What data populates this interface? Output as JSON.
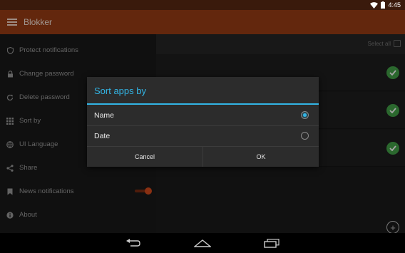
{
  "status_bar": {
    "time": "4:45",
    "icons": [
      "wifi-icon",
      "battery-icon"
    ]
  },
  "app": {
    "title": "Blokker",
    "brand_color": "#983d14"
  },
  "drawer": {
    "items": [
      {
        "label": "Protect notifications",
        "icon": "shield-icon"
      },
      {
        "label": "Change password",
        "icon": "lock-icon"
      },
      {
        "label": "Delete password",
        "icon": "refresh-icon"
      },
      {
        "label": "Sort by",
        "icon": "grid-icon"
      },
      {
        "label": "UI Language",
        "icon": "globe-icon"
      },
      {
        "label": "Share",
        "icon": "share-icon"
      },
      {
        "label": "News notifications",
        "icon": "bookmark-icon",
        "toggle": true
      },
      {
        "label": "About",
        "icon": "info-icon"
      }
    ]
  },
  "content": {
    "select_all_label": "Select all",
    "rows_checked": [
      true,
      true,
      true
    ],
    "check_color": "#43a047"
  },
  "dialog": {
    "title": "Sort apps by",
    "accent_color": "#33b5e5",
    "options": [
      {
        "label": "Name",
        "selected": true
      },
      {
        "label": "Date",
        "selected": false
      }
    ],
    "cancel_label": "Cancel",
    "ok_label": "OK"
  },
  "nav_bar": {
    "buttons": [
      "back-icon",
      "home-icon",
      "recents-icon"
    ]
  }
}
